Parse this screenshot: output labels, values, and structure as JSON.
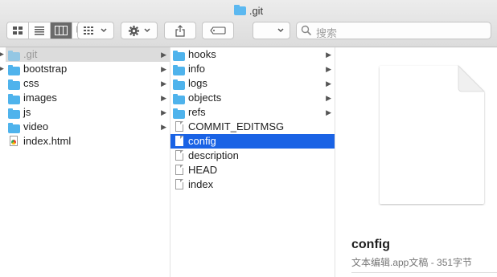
{
  "window": {
    "title": ".git"
  },
  "toolbar": {
    "search_placeholder": "搜索"
  },
  "column1": {
    "items": [
      {
        "label": ".git",
        "type": "folder",
        "state": "selected-inactive"
      },
      {
        "label": "bootstrap",
        "type": "folder"
      },
      {
        "label": "css",
        "type": "folder"
      },
      {
        "label": "images",
        "type": "folder"
      },
      {
        "label": "js",
        "type": "folder"
      },
      {
        "label": "video",
        "type": "folder"
      },
      {
        "label": "index.html",
        "type": "html"
      }
    ]
  },
  "column2": {
    "items": [
      {
        "label": "hooks",
        "type": "folder"
      },
      {
        "label": "info",
        "type": "folder"
      },
      {
        "label": "logs",
        "type": "folder"
      },
      {
        "label": "objects",
        "type": "folder"
      },
      {
        "label": "refs",
        "type": "folder"
      },
      {
        "label": "COMMIT_EDITMSG",
        "type": "file"
      },
      {
        "label": "config",
        "type": "file",
        "state": "selected-active"
      },
      {
        "label": "description",
        "type": "file"
      },
      {
        "label": "HEAD",
        "type": "file"
      },
      {
        "label": "index",
        "type": "file"
      }
    ]
  },
  "preview": {
    "name": "config",
    "info": "文本编辑.app文稿 - 351字节"
  },
  "colors": {
    "selection": "#1a63e5",
    "folder": "#4fb3ec"
  }
}
